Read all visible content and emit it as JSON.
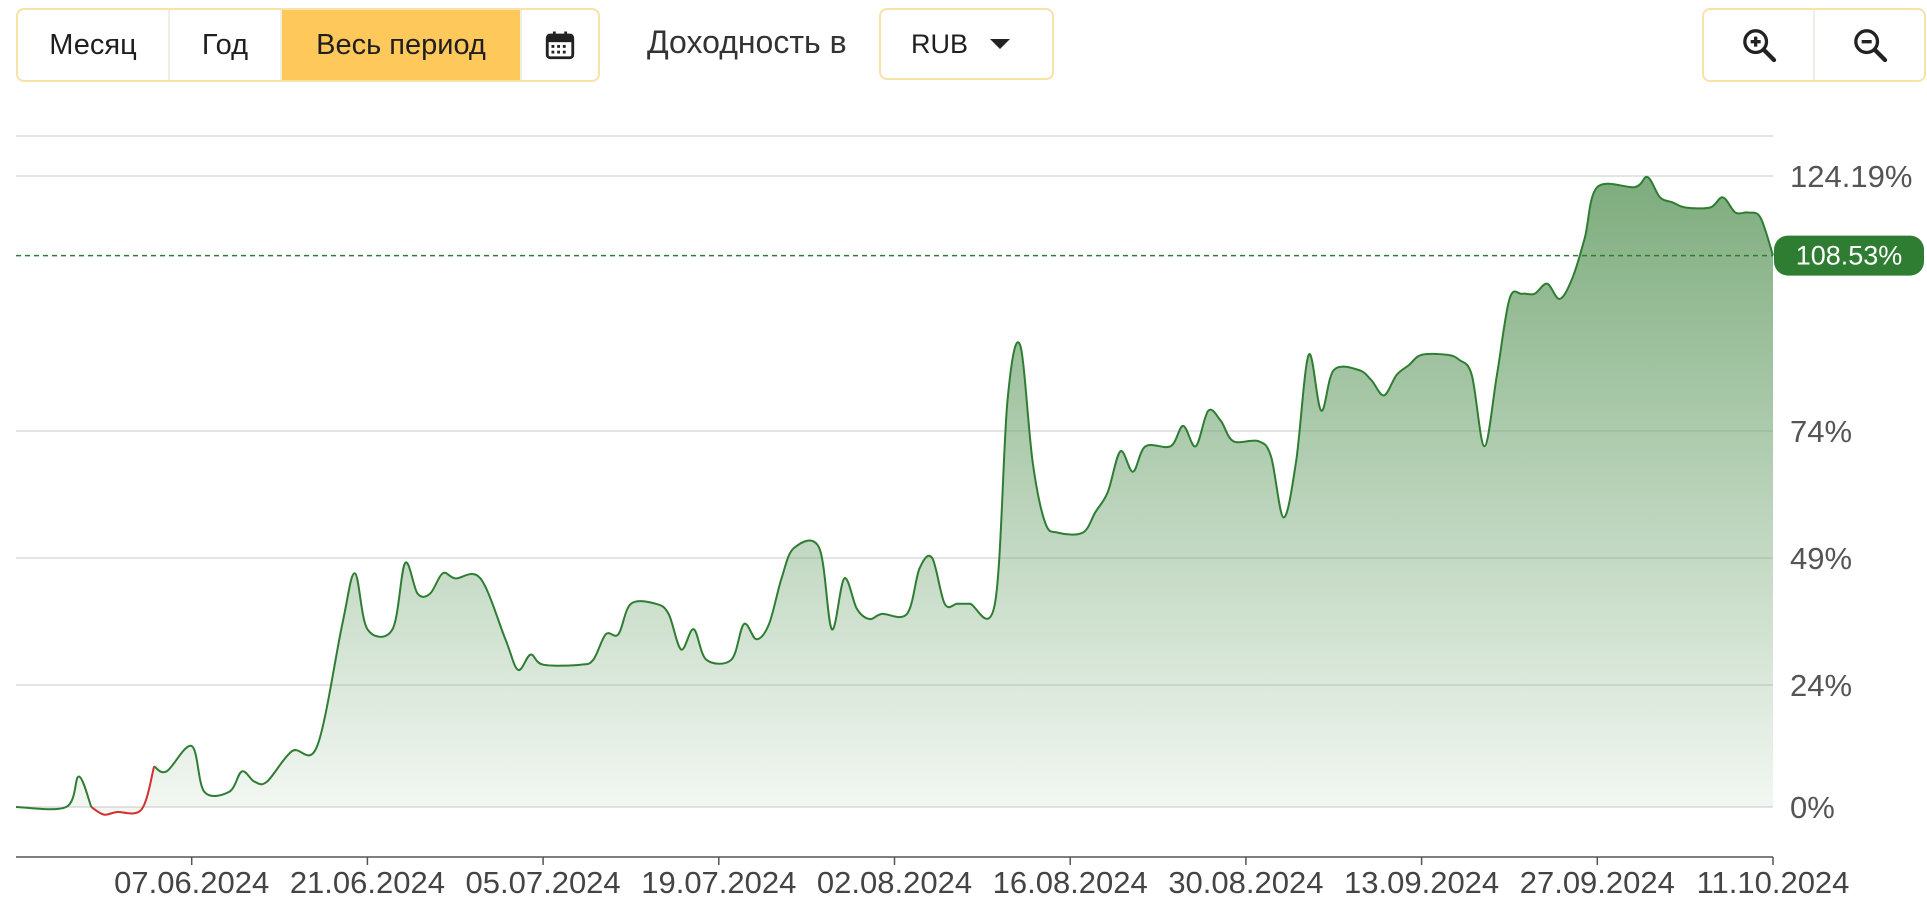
{
  "toolbar": {
    "periods": [
      "Месяц",
      "Год",
      "Весь период"
    ],
    "active_period": "Весь период",
    "calendar_icon": "calendar-icon",
    "currency_label": "Доходность в",
    "currency_value": "RUB",
    "zoom_in_icon": "zoom-in-icon",
    "zoom_out_icon": "zoom-out-icon"
  },
  "colors": {
    "line": "#2e7d32",
    "negative_line": "#d32f2f",
    "fill_top": "#6fa36f",
    "badge": "#2e7d32",
    "accent": "#ffc85a"
  },
  "chart_data": {
    "type": "area",
    "title": "",
    "xlabel": "",
    "ylabel": "",
    "y_unit": "%",
    "y_ticks": [
      "0%",
      "24%",
      "49%",
      "74%",
      "124.19%"
    ],
    "y_tick_values": [
      0,
      24,
      49,
      74,
      124.19
    ],
    "x_ticks": [
      "07.06.2024",
      "21.06.2024",
      "05.07.2024",
      "19.07.2024",
      "02.08.2024",
      "16.08.2024",
      "30.08.2024",
      "13.09.2024",
      "27.09.2024",
      "11.10.2024"
    ],
    "x_range": [
      "2024-05-24",
      "2024-10-11"
    ],
    "ylim": [
      -10,
      134
    ],
    "current_value": 108.53,
    "current_label": "108.53%",
    "grid": true,
    "series": [
      {
        "points": [
          [
            "2024-05-24",
            0
          ],
          [
            "2024-05-28",
            0
          ],
          [
            "2024-05-29",
            6
          ],
          [
            "2024-05-30",
            0
          ],
          [
            "2024-05-31",
            -1.5
          ],
          [
            "2024-06-01",
            -1
          ],
          [
            "2024-06-03",
            -0.5
          ],
          [
            "2024-06-04",
            8
          ],
          [
            "2024-06-05",
            7
          ],
          [
            "2024-06-07",
            12
          ],
          [
            "2024-06-08",
            3
          ],
          [
            "2024-06-10",
            3
          ],
          [
            "2024-06-11",
            7
          ],
          [
            "2024-06-12",
            5
          ],
          [
            "2024-06-13",
            5
          ],
          [
            "2024-06-15",
            11
          ],
          [
            "2024-06-17",
            12
          ],
          [
            "2024-06-19",
            36
          ],
          [
            "2024-06-20",
            46
          ],
          [
            "2024-06-21",
            35
          ],
          [
            "2024-06-23",
            35
          ],
          [
            "2024-06-24",
            48
          ],
          [
            "2024-06-25",
            42
          ],
          [
            "2024-06-26",
            42
          ],
          [
            "2024-06-27",
            46
          ],
          [
            "2024-06-28",
            45
          ],
          [
            "2024-06-30",
            45
          ],
          [
            "2024-07-02",
            33
          ],
          [
            "2024-07-03",
            27
          ],
          [
            "2024-07-04",
            30
          ],
          [
            "2024-07-05",
            28
          ],
          [
            "2024-07-08",
            28
          ],
          [
            "2024-07-09",
            29
          ],
          [
            "2024-07-10",
            34
          ],
          [
            "2024-07-11",
            34
          ],
          [
            "2024-07-12",
            40
          ],
          [
            "2024-07-14",
            40
          ],
          [
            "2024-07-15",
            38
          ],
          [
            "2024-07-16",
            31
          ],
          [
            "2024-07-17",
            35
          ],
          [
            "2024-07-18",
            29
          ],
          [
            "2024-07-20",
            29
          ],
          [
            "2024-07-21",
            36
          ],
          [
            "2024-07-22",
            33
          ],
          [
            "2024-07-23",
            36
          ],
          [
            "2024-07-24",
            45
          ],
          [
            "2024-07-25",
            51
          ],
          [
            "2024-07-27",
            51
          ],
          [
            "2024-07-28",
            35
          ],
          [
            "2024-07-29",
            45
          ],
          [
            "2024-07-30",
            39
          ],
          [
            "2024-07-31",
            37
          ],
          [
            "2024-08-01",
            38
          ],
          [
            "2024-08-03",
            38
          ],
          [
            "2024-08-04",
            47
          ],
          [
            "2024-08-05",
            49
          ],
          [
            "2024-08-06",
            40
          ],
          [
            "2024-08-07",
            40
          ],
          [
            "2024-08-08",
            40
          ],
          [
            "2024-08-10",
            40
          ],
          [
            "2024-08-11",
            80
          ],
          [
            "2024-08-12",
            91
          ],
          [
            "2024-08-13",
            68
          ],
          [
            "2024-08-14",
            56
          ],
          [
            "2024-08-15",
            54
          ],
          [
            "2024-08-17",
            54
          ],
          [
            "2024-08-18",
            58
          ],
          [
            "2024-08-19",
            62
          ],
          [
            "2024-08-20",
            70
          ],
          [
            "2024-08-21",
            66
          ],
          [
            "2024-08-22",
            71
          ],
          [
            "2024-08-24",
            71
          ],
          [
            "2024-08-25",
            75
          ],
          [
            "2024-08-26",
            71
          ],
          [
            "2024-08-27",
            78
          ],
          [
            "2024-08-28",
            76
          ],
          [
            "2024-08-29",
            72
          ],
          [
            "2024-08-31",
            72
          ],
          [
            "2024-09-01",
            69
          ],
          [
            "2024-09-02",
            57
          ],
          [
            "2024-09-03",
            68
          ],
          [
            "2024-09-04",
            89
          ],
          [
            "2024-09-05",
            78
          ],
          [
            "2024-09-06",
            86
          ],
          [
            "2024-09-08",
            86
          ],
          [
            "2024-09-09",
            84
          ],
          [
            "2024-09-10",
            81
          ],
          [
            "2024-09-11",
            85
          ],
          [
            "2024-09-12",
            87
          ],
          [
            "2024-09-13",
            89
          ],
          [
            "2024-09-15",
            89
          ],
          [
            "2024-09-16",
            88
          ],
          [
            "2024-09-17",
            85
          ],
          [
            "2024-09-18",
            71
          ],
          [
            "2024-09-19",
            85
          ],
          [
            "2024-09-20",
            100
          ],
          [
            "2024-09-21",
            101
          ],
          [
            "2024-09-22",
            101
          ],
          [
            "2024-09-23",
            103
          ],
          [
            "2024-09-24",
            100
          ],
          [
            "2024-09-25",
            104
          ],
          [
            "2024-09-26",
            112
          ],
          [
            "2024-09-27",
            122
          ],
          [
            "2024-09-30",
            122
          ],
          [
            "2024-10-01",
            124
          ],
          [
            "2024-10-02",
            120
          ],
          [
            "2024-10-03",
            119
          ],
          [
            "2024-10-04",
            118
          ],
          [
            "2024-10-06",
            118
          ],
          [
            "2024-10-07",
            120
          ],
          [
            "2024-10-08",
            117
          ],
          [
            "2024-10-09",
            117
          ],
          [
            "2024-10-10",
            116
          ],
          [
            "2024-10-11",
            108.53
          ]
        ]
      }
    ]
  }
}
